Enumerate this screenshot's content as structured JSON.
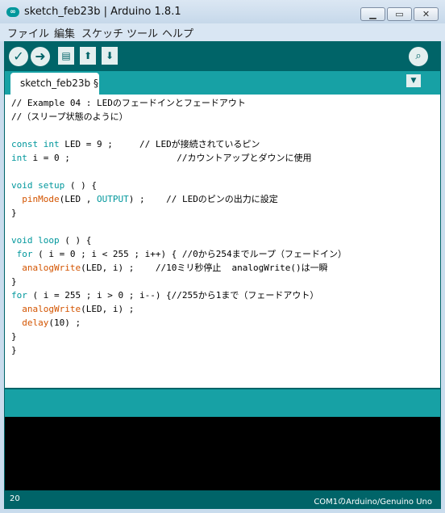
{
  "window": {
    "title": "sketch_feb23b | Arduino 1.8.1",
    "minimize_icon": "minimize-icon",
    "maximize_icon": "maximize-icon",
    "close_icon": "close-icon"
  },
  "menubar": {
    "items": [
      {
        "label": "ファイル"
      },
      {
        "label": "編集"
      },
      {
        "label": "スケッチ"
      },
      {
        "label": "ツール"
      },
      {
        "label": "ヘルプ"
      }
    ]
  },
  "toolbar": {
    "verify_icon": "checkmark-icon",
    "upload_icon": "arrow-right-icon",
    "new_icon": "new-file-icon",
    "open_icon": "arrow-up-icon",
    "save_icon": "arrow-down-icon",
    "serial_monitor_icon": "magnifier-icon"
  },
  "tabs": [
    {
      "label": "sketch_feb23b §"
    }
  ],
  "code": [
    {
      "segments": [
        {
          "t": "// Example 04 : LEDのフェードインとフェードアウト",
          "c": ""
        }
      ]
    },
    {
      "segments": [
        {
          "t": "//（スリープ状態のように）",
          "c": ""
        }
      ]
    },
    {
      "segments": []
    },
    {
      "segments": [
        {
          "t": "const",
          "c": "kw"
        },
        {
          "t": " ",
          "c": ""
        },
        {
          "t": "int",
          "c": "kw"
        },
        {
          "t": " LED = 9 ;     // LEDが接続されているピン",
          "c": ""
        }
      ]
    },
    {
      "segments": [
        {
          "t": "int",
          "c": "kw"
        },
        {
          "t": " i = 0 ;                    //カウントアップとダウンに使用",
          "c": ""
        }
      ]
    },
    {
      "segments": []
    },
    {
      "segments": [
        {
          "t": "void",
          "c": "kw"
        },
        {
          "t": " ",
          "c": ""
        },
        {
          "t": "setup",
          "c": "kw"
        },
        {
          "t": " ( ) {",
          "c": ""
        }
      ]
    },
    {
      "segments": [
        {
          "t": "  ",
          "c": ""
        },
        {
          "t": "pinMode",
          "c": "fn"
        },
        {
          "t": "(LED , ",
          "c": ""
        },
        {
          "t": "OUTPUT",
          "c": "const"
        },
        {
          "t": ") ;    // LEDのピンの出力に設定",
          "c": ""
        }
      ]
    },
    {
      "segments": [
        {
          "t": "}",
          "c": ""
        }
      ]
    },
    {
      "segments": []
    },
    {
      "segments": [
        {
          "t": "void",
          "c": "kw"
        },
        {
          "t": " ",
          "c": ""
        },
        {
          "t": "loop",
          "c": "kw"
        },
        {
          "t": " ( ) {",
          "c": ""
        }
      ]
    },
    {
      "segments": [
        {
          "t": " ",
          "c": ""
        },
        {
          "t": "for",
          "c": "kw"
        },
        {
          "t": " ( i = 0 ; i < 255 ; i++) { //0から254までループ（フェードイン）",
          "c": ""
        }
      ]
    },
    {
      "segments": [
        {
          "t": "  ",
          "c": ""
        },
        {
          "t": "analogWrite",
          "c": "fn"
        },
        {
          "t": "(LED, i) ;    //10ミリ秒停止  analogWrite()は一瞬",
          "c": ""
        }
      ]
    },
    {
      "segments": [
        {
          "t": "}",
          "c": ""
        }
      ]
    },
    {
      "segments": [
        {
          "t": "for",
          "c": "kw"
        },
        {
          "t": " ( i = 255 ; i > 0 ; i--) {//255から1まで（フェードアウト）",
          "c": ""
        }
      ]
    },
    {
      "segments": [
        {
          "t": "  ",
          "c": ""
        },
        {
          "t": "analogWrite",
          "c": "fn"
        },
        {
          "t": "(LED, i) ;",
          "c": ""
        }
      ]
    },
    {
      "segments": [
        {
          "t": "  ",
          "c": ""
        },
        {
          "t": "delay",
          "c": "fn"
        },
        {
          "t": "(10) ;",
          "c": ""
        }
      ]
    },
    {
      "segments": [
        {
          "t": "}",
          "c": ""
        }
      ]
    },
    {
      "segments": [
        {
          "t": "}",
          "c": ""
        }
      ]
    }
  ],
  "footer": {
    "line_number": "20",
    "board": "COM1のArduino/Genuino Uno"
  },
  "colors": {
    "teal_dark": "#006468",
    "teal_light": "#17a1a5",
    "keyword": "#00979c",
    "function": "#d35400"
  }
}
